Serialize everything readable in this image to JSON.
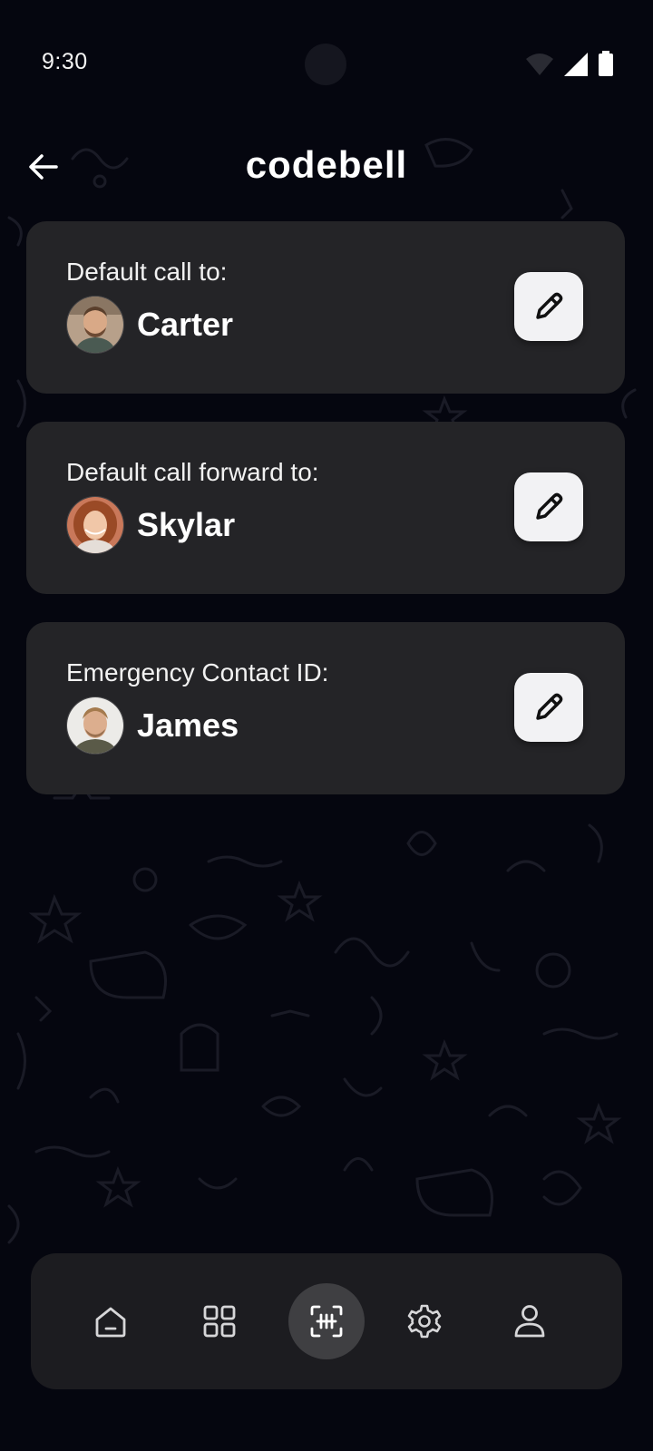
{
  "status_bar": {
    "time": "9:30",
    "icons": [
      "wifi-icon",
      "signal-icon",
      "battery-icon"
    ]
  },
  "header": {
    "title": "codebell",
    "back_icon": "arrow-left-icon"
  },
  "cards": [
    {
      "label": "Default call to:",
      "name": "Carter",
      "edit_icon": "pencil-icon"
    },
    {
      "label": "Default call forward to:",
      "name": "Skylar",
      "edit_icon": "pencil-icon"
    },
    {
      "label": "Emergency Contact ID:",
      "name": "James",
      "edit_icon": "pencil-icon"
    }
  ],
  "nav": {
    "items": [
      {
        "icon": "home-icon",
        "active": false
      },
      {
        "icon": "grid-icon",
        "active": false
      },
      {
        "icon": "scan-icon",
        "active": true
      },
      {
        "icon": "gear-icon",
        "active": false
      },
      {
        "icon": "profile-icon",
        "active": false
      }
    ]
  },
  "colors": {
    "background": "#05060f",
    "card": "#242427",
    "nav_bar": "#1c1c20",
    "nav_active": "#3f3f42",
    "edit_button": "#f2f2f4"
  }
}
